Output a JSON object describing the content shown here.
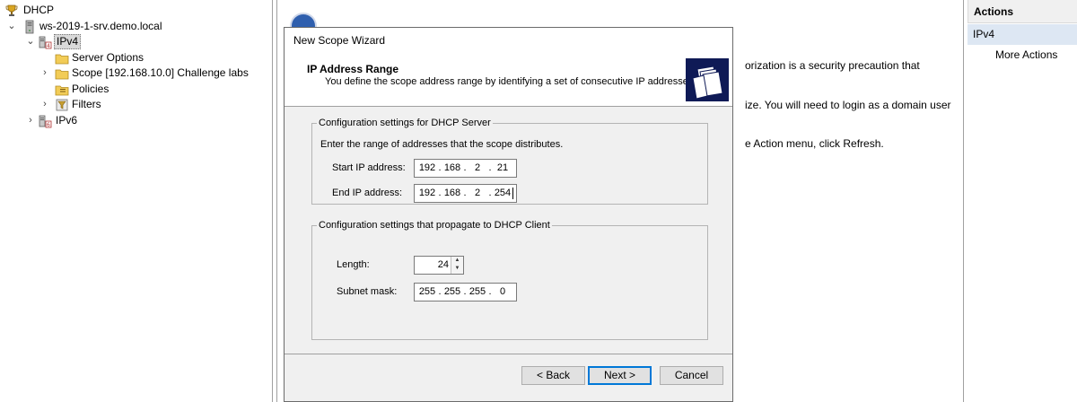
{
  "tree": {
    "root": "DHCP",
    "server": "ws-2019-1-srv.demo.local",
    "ipv4": "IPv4",
    "server_options": "Server Options",
    "scope": "Scope [192.168.10.0] Challenge labs",
    "policies": "Policies",
    "filters": "Filters",
    "ipv6": "IPv6",
    "expanded_glyph": "⌄",
    "collapsed_glyph": "›"
  },
  "background_text": {
    "line1": "orization is a security precaution that",
    "line2": "ize. You will need to login as a domain user",
    "line3": "e Action menu, click Refresh."
  },
  "actions": {
    "title": "Actions",
    "context": "IPv4",
    "more_actions": "More Actions"
  },
  "wizard": {
    "title": "New Scope Wizard",
    "header_title": "IP Address Range",
    "header_desc": "You define the scope address range by identifying a set of consecutive IP addresses.",
    "server_group": {
      "legend": "Configuration settings for DHCP Server",
      "instructions": "Enter the range of addresses that the scope distributes.",
      "start_label": "Start IP address:",
      "start_ip": [
        "192",
        "168",
        "2",
        "21"
      ],
      "end_label": "End IP address:",
      "end_ip": [
        "192",
        "168",
        "2",
        "254"
      ]
    },
    "client_group": {
      "legend": "Configuration settings that propagate to DHCP Client",
      "length_label": "Length:",
      "length_value": "24",
      "mask_label": "Subnet mask:",
      "mask": [
        "255",
        "255",
        "255",
        "0"
      ]
    },
    "buttons": {
      "back": "< Back",
      "next": "Next >",
      "cancel": "Cancel"
    }
  },
  "colors": {
    "header_art": "#0f1a56",
    "selection": "#d9d9d9",
    "actions_highlight": "#dde7f3",
    "default_button_border": "#0078d7"
  },
  "icons": {
    "root": "dhcp-trophy-icon",
    "server": "server-tower-icon",
    "ipv4": "ipv4-network-icon",
    "folder": "folder-icon",
    "policies": "policies-icon",
    "filters": "filter-icon",
    "ipv6": "ipv6-network-icon",
    "wizard_art": "wizard-folders-icon",
    "spin_up": "spin-up-icon",
    "spin_down": "spin-down-icon"
  }
}
